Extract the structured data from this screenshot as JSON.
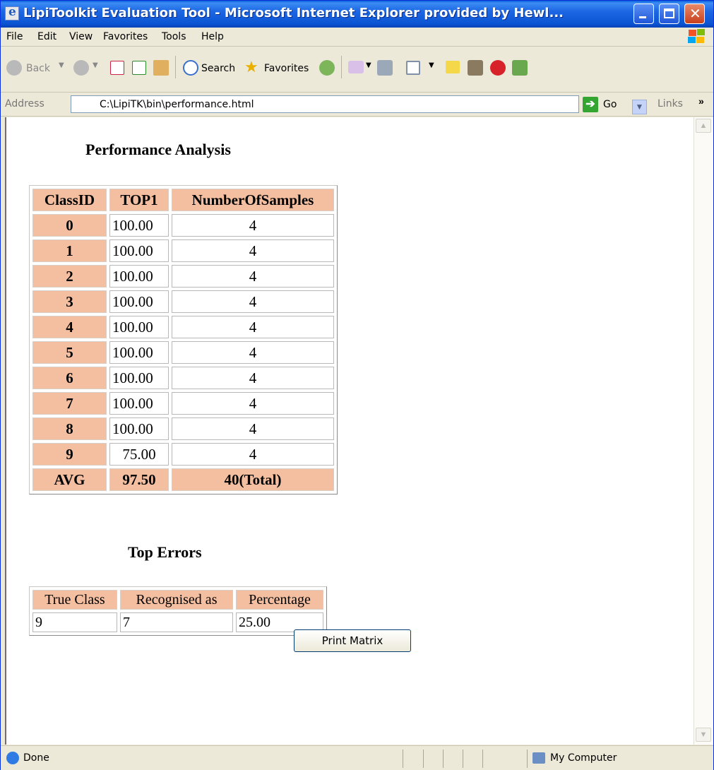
{
  "window": {
    "title": "LipiToolkit Evaluation Tool - Microsoft Internet Explorer provided by Hewl..."
  },
  "menu": [
    "File",
    "Edit",
    "View",
    "Favorites",
    "Tools",
    "Help"
  ],
  "toolbar": {
    "back": "Back",
    "search": "Search",
    "favorites": "Favorites"
  },
  "address": {
    "label": "Address",
    "value": "C:\\LipiTK\\bin\\performance.html",
    "go": "Go",
    "links": "Links"
  },
  "page": {
    "title": "Performance Analysis",
    "perf_headers": [
      "ClassID",
      "TOP1",
      "NumberOfSamples"
    ],
    "perf_rows": [
      [
        "0",
        "100.00",
        "4"
      ],
      [
        "1",
        "100.00",
        "4"
      ],
      [
        "2",
        "100.00",
        "4"
      ],
      [
        "3",
        "100.00",
        "4"
      ],
      [
        "4",
        "100.00",
        "4"
      ],
      [
        "5",
        "100.00",
        "4"
      ],
      [
        "6",
        "100.00",
        "4"
      ],
      [
        "7",
        "100.00",
        "4"
      ],
      [
        "8",
        "100.00",
        "4"
      ],
      [
        "9",
        "75.00",
        "4"
      ]
    ],
    "perf_avg": [
      "AVG",
      "97.50",
      "40(Total)"
    ],
    "errors_title": "Top Errors",
    "error_headers": [
      "True Class",
      "Recognised as",
      "Percentage"
    ],
    "error_rows": [
      [
        "9",
        "7",
        "25.00"
      ]
    ],
    "print_button": "Print Matrix"
  },
  "status": {
    "text": "Done",
    "zone": "My Computer"
  }
}
